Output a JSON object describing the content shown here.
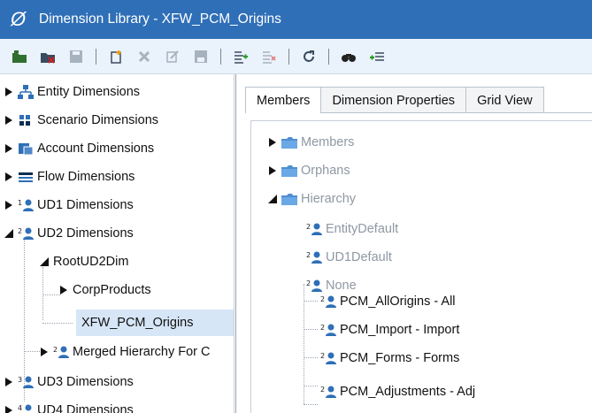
{
  "window": {
    "title": "Dimension Library - XFW_PCM_Origins"
  },
  "toolbar": {
    "icons": [
      "open-folder-icon",
      "delete-folder-icon",
      "save-icon",
      "new-member-icon",
      "delete-icon",
      "edit-icon",
      "save-as-icon",
      "move-in-icon",
      "remove-icon",
      "refresh-icon",
      "search-icon",
      "add-rows-icon"
    ]
  },
  "left_tree": {
    "items": [
      {
        "label": "Entity Dimensions"
      },
      {
        "label": "Scenario Dimensions"
      },
      {
        "label": "Account Dimensions"
      },
      {
        "label": "Flow Dimensions"
      },
      {
        "label": "UD1 Dimensions"
      },
      {
        "label": "UD2 Dimensions"
      },
      {
        "label": "RootUD2Dim"
      },
      {
        "label": "CorpProducts"
      },
      {
        "label": "XFW_PCM_Origins"
      },
      {
        "label": "Merged Hierarchy For C"
      },
      {
        "label": "UD3 Dimensions"
      },
      {
        "label": "UD4 Dimensions"
      }
    ]
  },
  "tabs": [
    {
      "label": "Members"
    },
    {
      "label": "Dimension Properties"
    },
    {
      "label": "Grid View"
    }
  ],
  "members_tree": {
    "items": [
      {
        "label": "Members"
      },
      {
        "label": "Orphans"
      },
      {
        "label": "Hierarchy"
      },
      {
        "label": "EntityDefault"
      },
      {
        "label": "UD1Default"
      },
      {
        "label": "None"
      },
      {
        "label": "PCM_AllOrigins - All"
      },
      {
        "label": "PCM_Import - Import"
      },
      {
        "label": "PCM_Forms - Forms"
      },
      {
        "label": "PCM_Adjustments - Adj"
      }
    ]
  },
  "colors": {
    "titlebar": "#2f6fb7",
    "toolbar": "#eaf2fb",
    "selection": "#d7e6f7",
    "muted_text": "#8f98a3"
  }
}
